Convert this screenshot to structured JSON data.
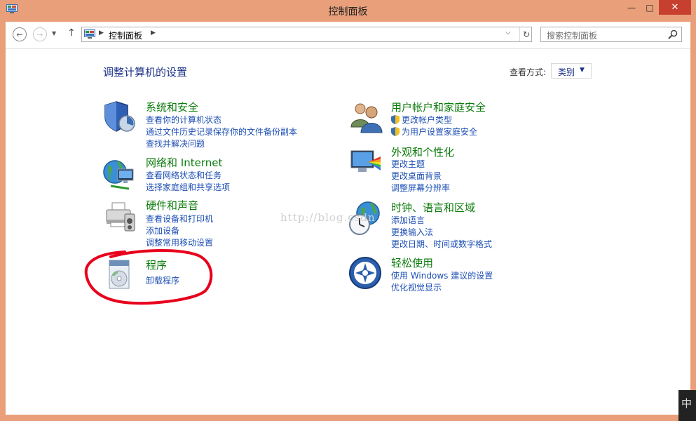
{
  "window": {
    "title": "控制面板",
    "minimize": "—",
    "maximize": "□",
    "close": "✕"
  },
  "nav": {
    "back": "←",
    "forward": "→",
    "recent": "▼",
    "up": "↑",
    "address": {
      "sep": "▶",
      "crumb": "控制面板",
      "dropdown": "⌵",
      "refresh": "↻"
    },
    "search_placeholder": "搜索控制面板"
  },
  "header": {
    "title": "调整计算机的设置",
    "view_by_label": "查看方式:",
    "view_by_value": "类别",
    "view_by_arrow": "▼"
  },
  "categories": [
    {
      "icon": "system-security-shield-icon",
      "title": "系统和安全",
      "links": [
        "查看你的计算机状态",
        "通过文件历史记录保存你的文件备份副本",
        "查找并解决问题"
      ]
    },
    {
      "icon": "network-globe-icon",
      "title": "网络和 Internet",
      "links": [
        "查看网络状态和任务",
        "选择家庭组和共享选项"
      ]
    },
    {
      "icon": "hardware-printer-icon",
      "title": "硬件和声音",
      "links": [
        "查看设备和打印机",
        "添加设备",
        "调整常用移动设置"
      ]
    },
    {
      "icon": "programs-disc-icon",
      "title": "程序",
      "links": [
        "卸载程序"
      ]
    },
    {
      "icon": "user-accounts-icon",
      "title": "用户帐户和家庭安全",
      "links": [
        "更改帐户类型",
        "为用户设置家庭安全"
      ]
    },
    {
      "icon": "appearance-monitor-icon",
      "title": "外观和个性化",
      "links": [
        "更改主题",
        "更改桌面背景",
        "调整屏幕分辨率"
      ]
    },
    {
      "icon": "clock-globe-icon",
      "title": "时钟、语言和区域",
      "links": [
        "添加语言",
        "更换输入法",
        "更改日期、时间或数字格式"
      ]
    },
    {
      "icon": "ease-of-access-icon",
      "title": "轻松使用",
      "links": [
        "使用 Windows 建议的设置",
        "优化视觉显示"
      ]
    }
  ],
  "watermark": "http://blog.csdn",
  "ime": "中",
  "colors": {
    "frame": "#e9a07a",
    "close": "#c7402f",
    "title_blue": "#1e3287",
    "category_green": "#0b7b0b",
    "link_blue": "#1e4fb4",
    "annotation_red": "#e8001c"
  }
}
